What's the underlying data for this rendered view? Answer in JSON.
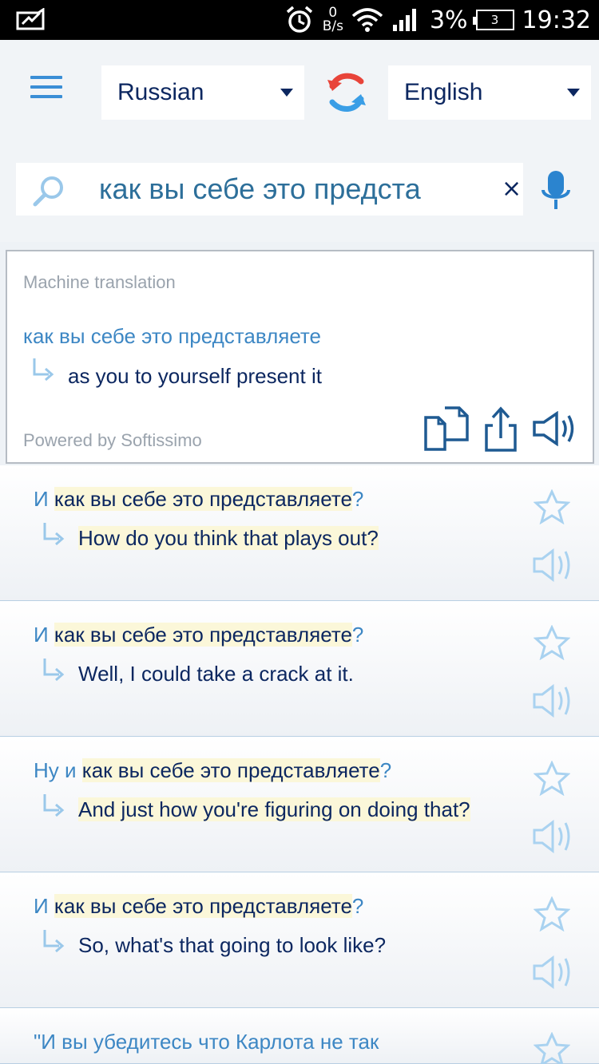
{
  "status_bar": {
    "speed_value": "0",
    "speed_unit": "B/s",
    "battery_percent": "3%",
    "battery_level": "3",
    "time": "19:32"
  },
  "header": {
    "source_language": "Russian",
    "target_language": "English"
  },
  "search": {
    "query": "как вы себе это предста",
    "clear_symbol": "×"
  },
  "machine_translation": {
    "caption": "Machine translation",
    "source_text": "как вы себе это представляете",
    "translation": "as you to yourself present it",
    "powered_by": "Powered by Softissimo"
  },
  "examples": [
    {
      "pre": "И ",
      "hl": "как вы себе это представляете",
      "post": "?",
      "target": "How do you think that plays out?"
    },
    {
      "pre": "И ",
      "hl": "как вы себе это представляете",
      "post": "?",
      "target": "Well, I could take a crack at it."
    },
    {
      "pre": "Ну и ",
      "hl": "как вы себе это представляете",
      "post": "?",
      "target": "And just how you're figuring on doing that?"
    },
    {
      "pre": "И ",
      "hl": "как вы себе это представляете",
      "post": "?",
      "target": "So, what's that going to look like?"
    },
    {
      "pre": "\"И вы убедитесь что Карлота не так",
      "hl": "",
      "post": "",
      "target": ""
    }
  ],
  "colors": {
    "accent_blue": "#3a8ed6",
    "navy_text": "#0c2760",
    "source_blue": "#3d87c4",
    "highlight": "#fbf7d9"
  },
  "icons": {
    "menu": "hamburger-icon",
    "swap": "swap-languages-icon",
    "search": "search-icon",
    "mic": "microphone-icon",
    "copy": "copy-icon",
    "share": "share-icon",
    "speak": "speaker-icon",
    "favorite": "star-icon"
  }
}
